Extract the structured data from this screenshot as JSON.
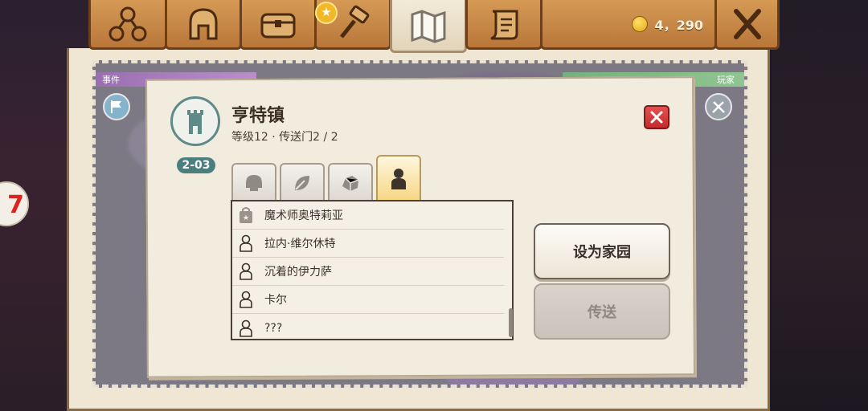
{
  "header": {
    "coins": "4，290",
    "tabs": [
      {
        "name": "skills",
        "icon": "skill-tree-icon"
      },
      {
        "name": "gear",
        "icon": "helmet-icon"
      },
      {
        "name": "bag",
        "icon": "chest-icon"
      },
      {
        "name": "craft",
        "icon": "hammer-icon"
      },
      {
        "name": "map",
        "icon": "map-icon",
        "active": true
      },
      {
        "name": "quests",
        "icon": "scroll-icon"
      }
    ]
  },
  "map": {
    "event_label": "事件",
    "player_label": "玩家"
  },
  "dialog": {
    "town_name": "亨特镇",
    "subtitle": "等级12 · 传送门2 / 2",
    "zone_code": "2-03",
    "category_tabs": [
      {
        "icon": "monster-skull-icon",
        "active": false
      },
      {
        "icon": "leaf-icon",
        "active": false
      },
      {
        "icon": "ore-rock-icon",
        "active": false
      },
      {
        "icon": "person-icon",
        "active": true
      }
    ],
    "npcs": [
      {
        "name": "魔术师奥特莉亚",
        "icon": "shop-bag-icon"
      },
      {
        "name": "拉内·维尔休特",
        "icon": "person-outline-icon"
      },
      {
        "name": "沉着的伊力萨",
        "icon": "person-outline-icon"
      },
      {
        "name": "卡尔",
        "icon": "person-outline-icon"
      },
      {
        "name": "???",
        "icon": "person-outline-icon"
      }
    ],
    "set_home_label": "设为家园",
    "teleport_label": "传送"
  },
  "colors": {
    "wood": "#c4843f",
    "parchment": "#f2ecdf",
    "teal": "#4b7f7e",
    "close_red": "#d63a3a",
    "active_tab_gold": "#f6d682"
  }
}
